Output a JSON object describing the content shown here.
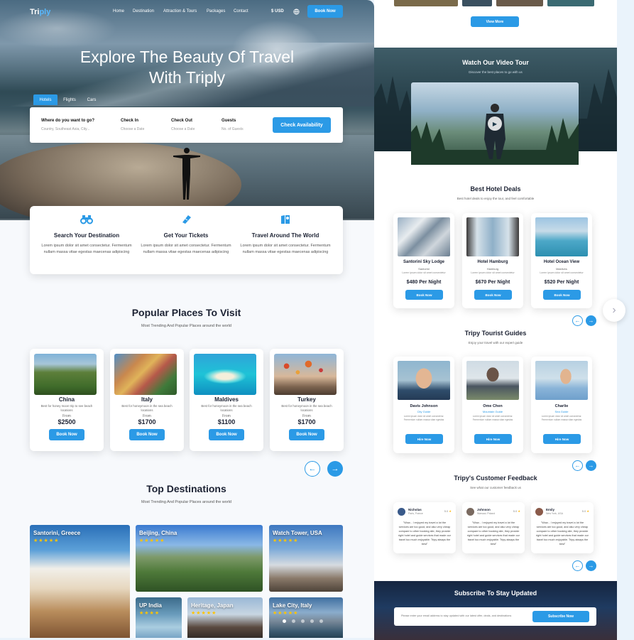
{
  "nav": {
    "logo_a": "Tri",
    "logo_b": "ply",
    "links": [
      "Home",
      "Destination",
      "Attraction & Tours",
      "Packages",
      "Contact"
    ],
    "currency": "$ USD",
    "book_label": "Book Now"
  },
  "hero": {
    "title_line1": "Explore The Beauty Of Travel",
    "title_line2": "With Triply",
    "tabs": [
      "Hotels",
      "Flights",
      "Cars"
    ],
    "fields": [
      {
        "label": "Where do you want to go?",
        "placeholder": "Country, Southeast Asia, City..."
      },
      {
        "label": "Check In",
        "placeholder": "Choose a Date"
      },
      {
        "label": "Check Out",
        "placeholder": "Choose a Date"
      },
      {
        "label": "Guests",
        "placeholder": "No. of Guests"
      }
    ],
    "check_label": "Check Availability"
  },
  "features": [
    {
      "title": "Search Your Destination",
      "desc": "Lorem ipsum dolor sit amet consectetur. Fermentum nullam massa vitae egestas maecenas adipiscing"
    },
    {
      "title": "Get Your Tickets",
      "desc": "Lorem ipsum dolor sit amet consectetur. Fermentum nullam massa vitae egestas maecenas adipiscing"
    },
    {
      "title": "Travel Around The World",
      "desc": "Lorem ipsum dolor sit amet consectetur. Fermentum nullam massa vitae egestas maecenas adipiscing"
    }
  ],
  "popular": {
    "title": "Popular Places To Visit",
    "subtitle": "Most Trending And Popular Places around the world",
    "places": [
      {
        "name": "China",
        "desc": "Best for honey moon trip to see beach locations",
        "from": "From",
        "price": "$2500",
        "btn": "Book Now"
      },
      {
        "name": "Italy",
        "desc": "Best for honeymoon in the sea beach locations",
        "from": "From",
        "price": "$1700",
        "btn": "Book Now"
      },
      {
        "name": "Maldives",
        "desc": "Best for honeymoon in the sea beach locations",
        "from": "From",
        "price": "$1100",
        "btn": "Book Now"
      },
      {
        "name": "Turkey",
        "desc": "Best for honeymoon in the sea beach locations",
        "from": "From",
        "price": "$1700",
        "btn": "Book Now"
      }
    ]
  },
  "top": {
    "title": "Top Destinations",
    "subtitle": "Most Trending And Popular Places around the world",
    "items": [
      {
        "name": "Santorini, Greece",
        "stars": "★★★★★"
      },
      {
        "name": "Beijing, China",
        "stars": "★★★★★"
      },
      {
        "name": "Watch Tower, USA",
        "stars": "★★★★★"
      },
      {
        "name": "UP India",
        "stars": "★★★★"
      },
      {
        "name": "Heritage, Japan",
        "stars": "★★★★★"
      },
      {
        "name": "Lake City, Italy",
        "stars": "★★★★★"
      }
    ]
  },
  "right": {
    "view_more": "View More",
    "video": {
      "title": "Watch Our Video Tour",
      "subtitle": "Discover the best places to go with us"
    },
    "hotels": {
      "title": "Best Hotel Deals",
      "subtitle": "Best hotel deals to enjoy the tour, and feel comfortable",
      "items": [
        {
          "name": "Santorini Sky Lodge",
          "loc": "Santorini",
          "desc": "Lorem ipsum dolor sit amet consectetur",
          "price": "$480 Per Night",
          "btn": "Book Now"
        },
        {
          "name": "Hotel Hamburg",
          "loc": "Hamburg",
          "desc": "Lorem ipsum dolor sit amet consectetur",
          "price": "$670 Per Night",
          "btn": "Book Now"
        },
        {
          "name": "Hotel Ocean View",
          "loc": "Maldives",
          "desc": "Lorem ipsum dolor sit amet consectetur",
          "price": "$520 Per Night",
          "btn": "Book Now"
        }
      ]
    },
    "guides": {
      "title": "Tripy Tourist Guides",
      "subtitle": "Enjoy your travel with our expert guide",
      "items": [
        {
          "name": "Davis Johnson",
          "role": "City Guide",
          "desc": "Lorem ipsum dolor sit amet consectetur. Fermentum nullam massa vitae egestas",
          "btn": "Hire Now"
        },
        {
          "name": "Ome Chen",
          "role": "Mountain Guide",
          "desc": "Lorem ipsum dolor sit amet consectetur. Fermentum nullam massa vitae egestas",
          "btn": "Hire Now"
        },
        {
          "name": "Charlie",
          "role": "Sea Guide",
          "desc": "Lorem ipsum dolor sit amet consectetur. Fermentum nullam massa vitae egestas",
          "btn": "Hire Now"
        }
      ]
    },
    "feedback": {
      "title": "Tripy's Customer Feedback",
      "subtitle": "See what our customer feedback us",
      "items": [
        {
          "name": "Nicholas",
          "loc": "Paris, France",
          "score": "5.0",
          "quote": "\"Wow... I enjoyed my travel a lot the services are too good, and also very cheap compare to other booking site, they provide right hotel and guide services that made our travel too much enjoyable. Tripy always the best\""
        },
        {
          "name": "Johnson",
          "loc": "Warsaw, Poland",
          "score": "5.0",
          "quote": "\"Wow... I enjoyed my travel a lot the services are too good, and also very cheap compare to other booking site, they provide right hotel and guide services that made our travel too much enjoyable. Tripy always the best\""
        },
        {
          "name": "Emily",
          "loc": "New York, USA",
          "score": "5.0",
          "quote": "\"Wow... I enjoyed my travel a lot the services are too good, and also very cheap compare to other booking site, they provide right hotel and guide services that made our travel too much enjoyable. Tripy always the best\""
        }
      ]
    },
    "subscribe": {
      "title": "Subscribe To Stay Updated",
      "placeholder": "Please enter your email address to stay updated with our latest offer, deals, and destinations",
      "btn": "Subscribe Now"
    }
  }
}
